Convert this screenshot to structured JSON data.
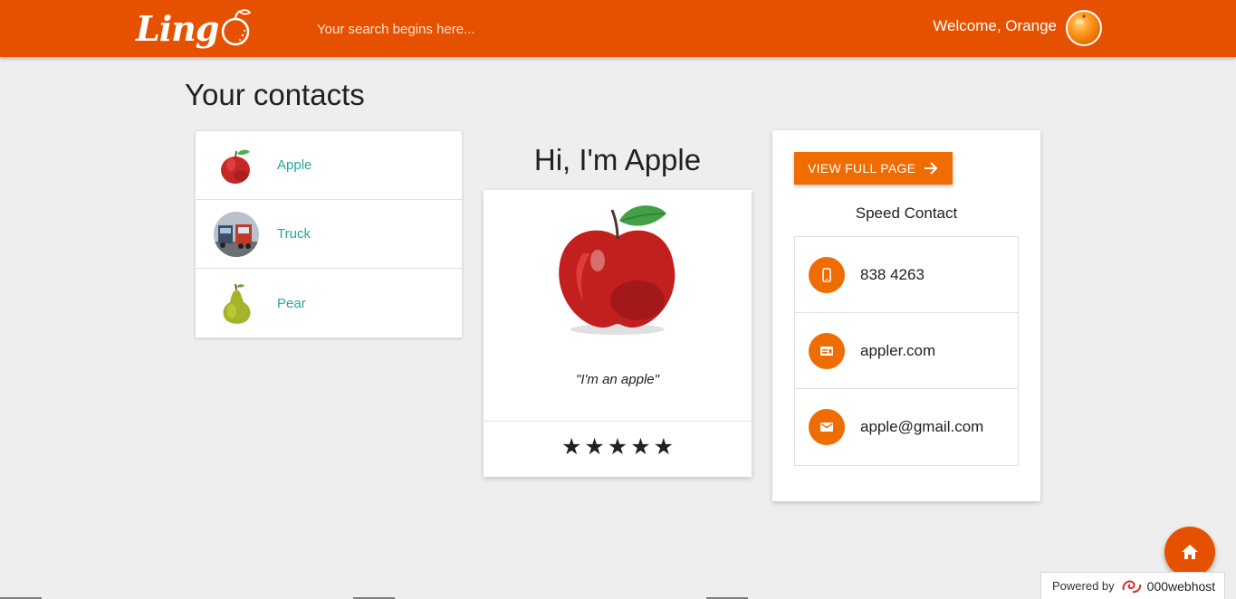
{
  "header": {
    "logo_text": "Ling",
    "search_placeholder": "Your search begins here...",
    "welcome": "Welcome, Orange",
    "brand_color": "#e65100"
  },
  "page": {
    "title": "Your contacts"
  },
  "contacts": [
    {
      "name": "Apple",
      "avatar": "apple-image"
    },
    {
      "name": "Truck",
      "avatar": "truck-image"
    },
    {
      "name": "Pear",
      "avatar": "pear-image"
    }
  ],
  "profile": {
    "greeting": "Hi, I'm Apple",
    "quote": "\"I'm an apple\"",
    "rating": 5,
    "rating_max": 5,
    "star_glyph": "★"
  },
  "speed_contact": {
    "button_label": "VIEW FULL PAGE",
    "title": "Speed Contact",
    "items": [
      {
        "icon": "phone-icon",
        "text": "838 4263"
      },
      {
        "icon": "web-icon",
        "text": "appler.com"
      },
      {
        "icon": "email-icon",
        "text": "apple@gmail.com"
      }
    ],
    "accent": "#ef6c00"
  },
  "footer": {
    "powered_by": "Powered by",
    "host": "000webhost"
  }
}
